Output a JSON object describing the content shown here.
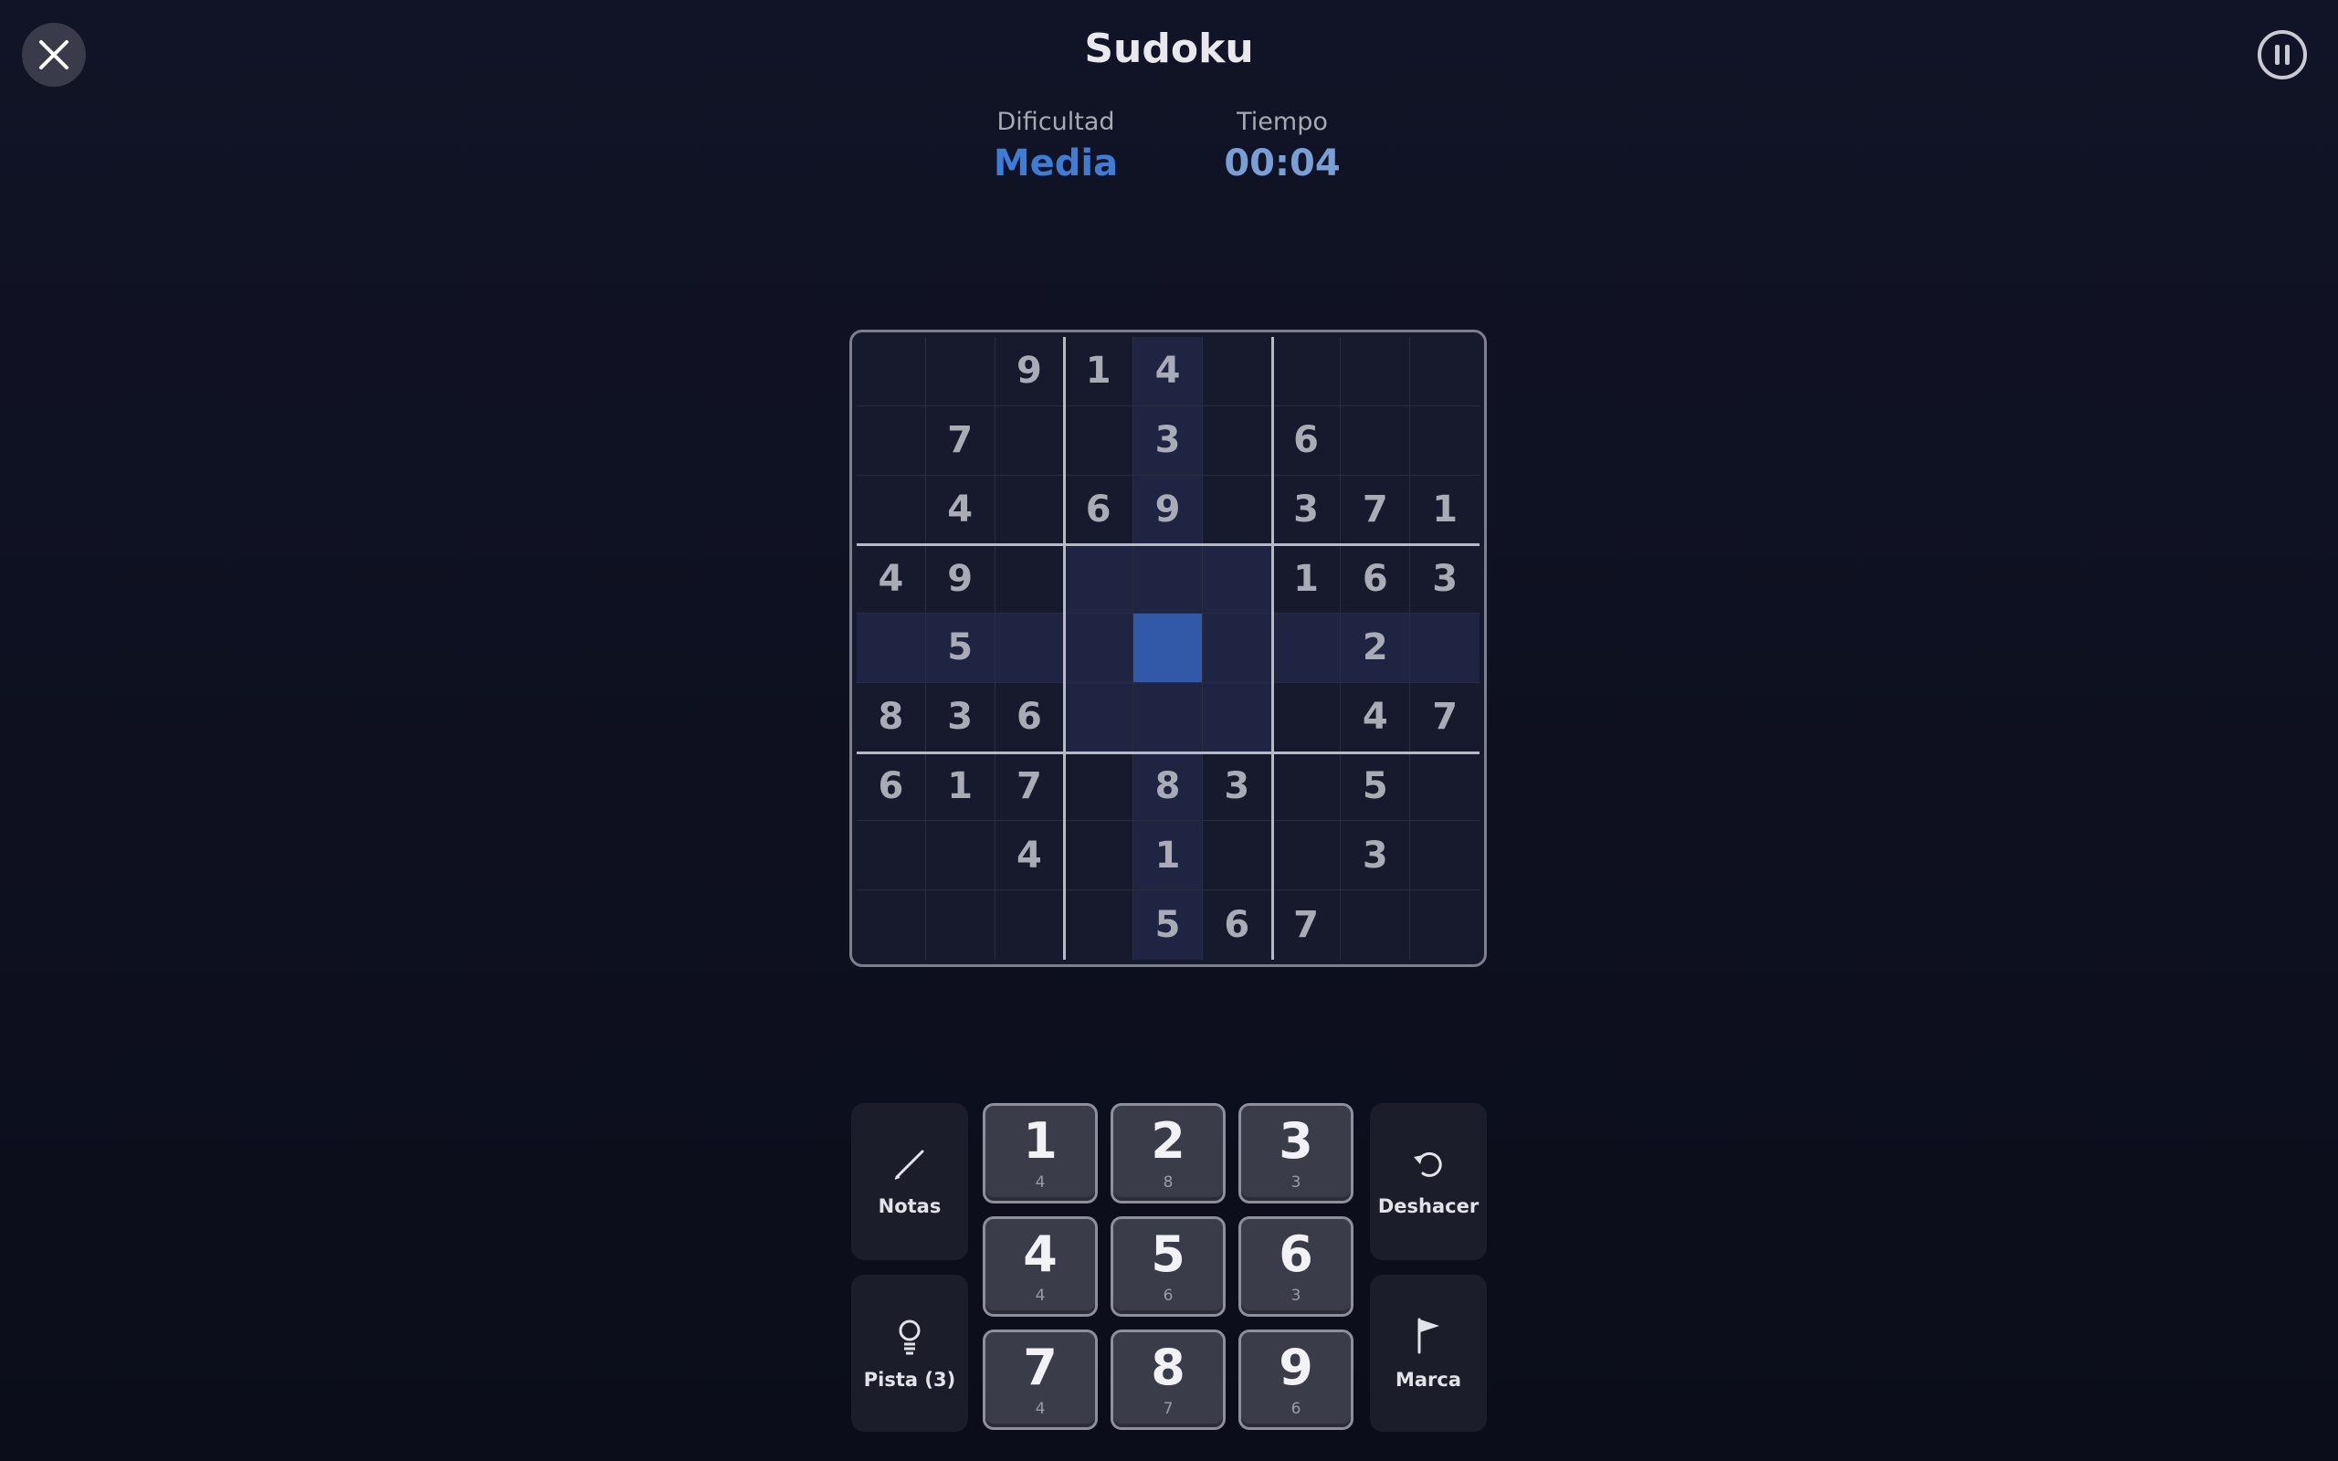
{
  "header": {
    "title": "Sudoku",
    "difficulty_label": "Dificultad",
    "difficulty_value": "Media",
    "time_label": "Tiempo",
    "time_value": "00:04"
  },
  "colors": {
    "accent": "#3f7cd6",
    "time": "#7a9fd6",
    "selected_cell": "#3159a8",
    "highlight_cell": "#1e2442"
  },
  "board": {
    "rows": [
      [
        "",
        "",
        "9",
        "1",
        "4",
        "",
        "",
        "",
        ""
      ],
      [
        "",
        "7",
        "",
        "",
        "3",
        "",
        "6",
        "",
        ""
      ],
      [
        "",
        "4",
        "",
        "6",
        "9",
        "",
        "3",
        "7",
        "1"
      ],
      [
        "4",
        "9",
        "",
        "",
        "",
        "",
        "1",
        "6",
        "3"
      ],
      [
        "",
        "5",
        "",
        "",
        "",
        "",
        "",
        "2",
        ""
      ],
      [
        "8",
        "3",
        "6",
        "",
        "",
        "",
        "",
        "4",
        "7"
      ],
      [
        "6",
        "1",
        "7",
        "",
        "8",
        "3",
        "",
        "5",
        ""
      ],
      [
        "",
        "",
        "4",
        "",
        "1",
        "",
        "",
        "3",
        ""
      ],
      [
        "",
        "",
        "",
        "",
        "5",
        "6",
        "7",
        "",
        ""
      ]
    ],
    "selected": {
      "row": 4,
      "col": 4
    }
  },
  "tools": {
    "notes": {
      "label": "Notas",
      "icon": "pencil-icon"
    },
    "hint": {
      "label": "Pista (3)",
      "icon": "lightbulb-icon"
    },
    "undo": {
      "label": "Deshacer",
      "icon": "undo-icon"
    },
    "mark": {
      "label": "Marca",
      "icon": "flag-icon"
    }
  },
  "numpad": [
    {
      "digit": "1",
      "remaining": "4"
    },
    {
      "digit": "2",
      "remaining": "8"
    },
    {
      "digit": "3",
      "remaining": "3"
    },
    {
      "digit": "4",
      "remaining": "4"
    },
    {
      "digit": "5",
      "remaining": "6"
    },
    {
      "digit": "6",
      "remaining": "3"
    },
    {
      "digit": "7",
      "remaining": "4"
    },
    {
      "digit": "8",
      "remaining": "7"
    },
    {
      "digit": "9",
      "remaining": "6"
    }
  ]
}
